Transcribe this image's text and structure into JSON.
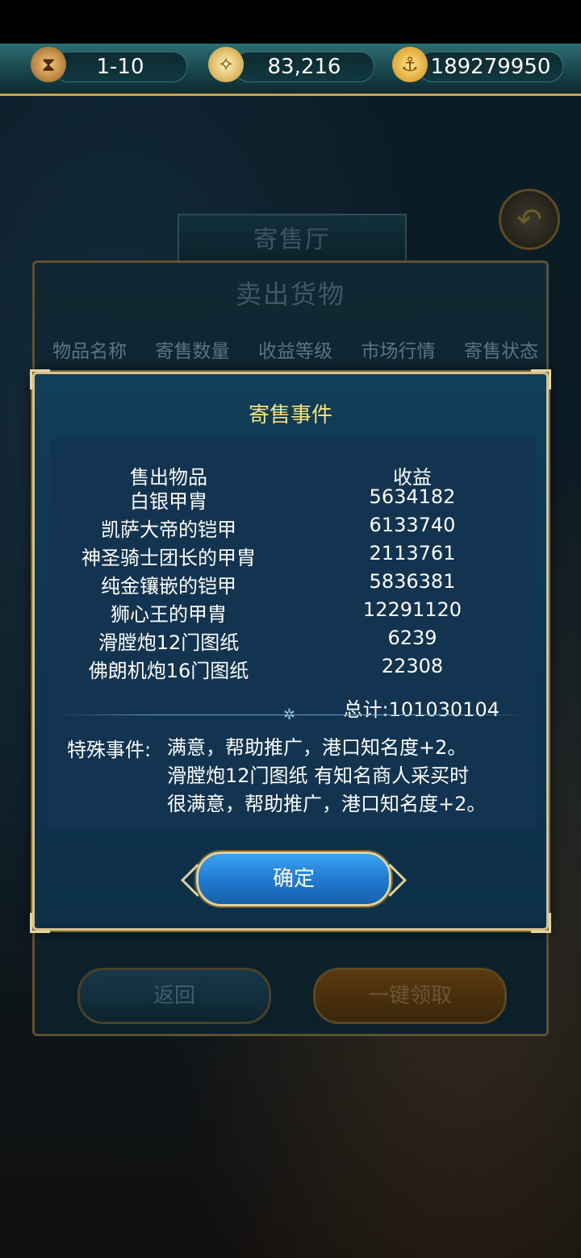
{
  "resources": {
    "turn": "1-10",
    "compass": "83,216",
    "gold": "189279950"
  },
  "icons": {
    "turn": "hourglass-icon",
    "compass": "compass-icon",
    "gold": "anchor-coin-icon",
    "back": "return-arrow-icon"
  },
  "background": {
    "hall_title": "寄售厅",
    "panel_title": "卖出货物",
    "columns": [
      "物品名称",
      "寄售数量",
      "收益等级",
      "市场行情",
      "寄售状态"
    ],
    "return_label": "返回",
    "claim_label": "一键领取"
  },
  "modal": {
    "title": "寄售事件",
    "header_item": "售出物品",
    "header_income": "收益",
    "rows": [
      {
        "item": "白银甲胄",
        "income": "5634182"
      },
      {
        "item": "凯萨大帝的铠甲",
        "income": "6133740"
      },
      {
        "item": "神圣骑士团长的甲胄",
        "income": "2113761"
      },
      {
        "item": "纯金镶嵌的铠甲",
        "income": "5836381"
      },
      {
        "item": "狮心王的甲胄",
        "income": "12291120"
      },
      {
        "item": "滑膛炮12门图纸",
        "income": "6239"
      },
      {
        "item": "佛朗机炮16门图纸",
        "income": "22308"
      }
    ],
    "total": "总计:101030104",
    "special_label": "特殊事件:",
    "special_lines": [
      "满意，帮助推广，港口知名度+2。",
      "滑膛炮12门图纸 有知名商人采买时",
      "很满意，帮助推广，港口知名度+2。"
    ],
    "confirm_label": "确定"
  },
  "colors": {
    "modal_title": "#f4e27a",
    "confirm_button": "#1f79cf",
    "frame_gold": "#d9c28a"
  }
}
